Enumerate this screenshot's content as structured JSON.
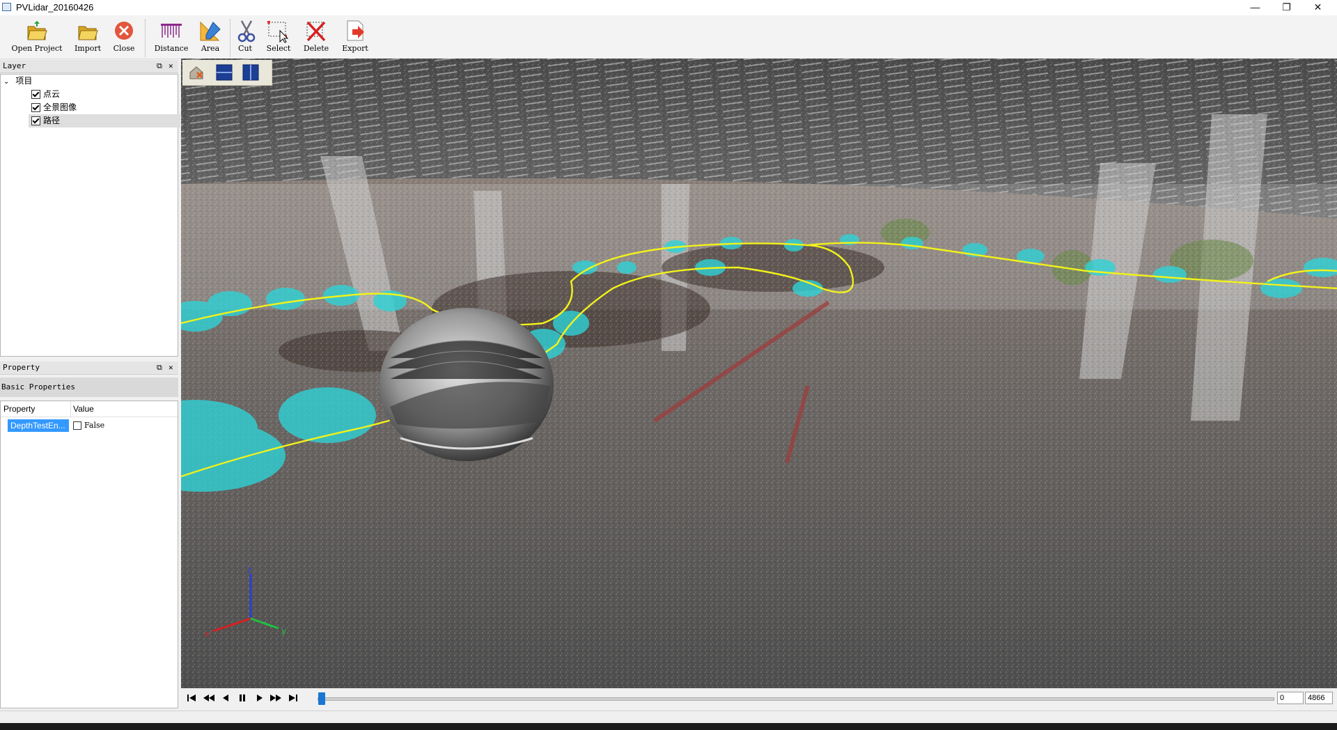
{
  "window": {
    "title": "PVLidar_20160426",
    "min": "—",
    "max": "❐",
    "close": "✕"
  },
  "toolbar": {
    "open_project": "Open Project",
    "import": "Import",
    "close": "Close",
    "distance": "Distance",
    "area": "Area",
    "cut": "Cut",
    "select": "Select",
    "delete": "Delete",
    "export": "Export"
  },
  "layer_panel": {
    "title": "Layer",
    "root": "项目",
    "items": [
      {
        "label": "点云"
      },
      {
        "label": "全景图像"
      },
      {
        "label": "路径"
      }
    ]
  },
  "property_panel": {
    "title": "Property",
    "group": "Basic Properties",
    "col_property": "Property",
    "col_value": "Value",
    "row_property": "DepthTestEn...",
    "row_value": "False"
  },
  "player": {
    "current_frame": "0",
    "total_frames": "4866",
    "progress": 0.0
  },
  "axis": {
    "x": "x",
    "y": "y",
    "z": "z"
  },
  "colors": {
    "path": "#f2f21a",
    "disc": "#2fd2d6",
    "selection": "#3399ff"
  }
}
